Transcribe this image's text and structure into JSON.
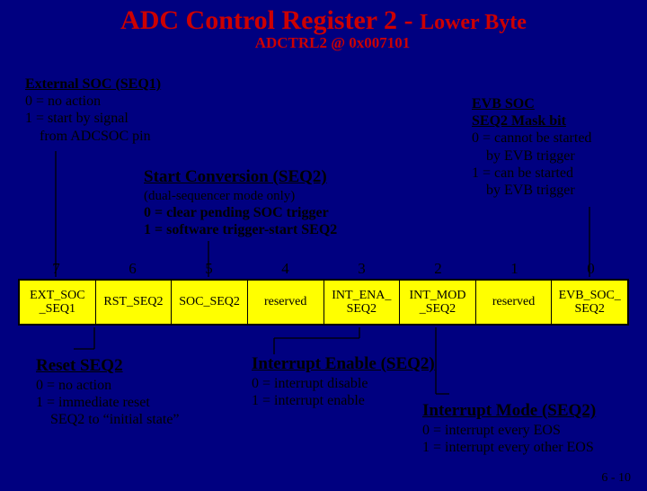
{
  "title_main": "ADC Control Register 2",
  "title_dash": " - ",
  "title_sub": "Lower Byte",
  "subtitle": "ADCTRL2 @ 0x007101",
  "ext_soc": {
    "hdr": "External SOC (SEQ1)",
    "l0": "0 = no action",
    "l1": "1 = start by signal",
    "l2": "    from ADCSOC pin"
  },
  "start_conv": {
    "hdr": "Start Conversion (SEQ2)",
    "note": "(dual-sequencer mode only)",
    "l0": "0 = clear pending SOC trigger",
    "l1": "1 = software trigger-start SEQ2"
  },
  "evb": {
    "hdr1": "EVB SOC",
    "hdr2": "SEQ2 Mask bit",
    "l0": "0 = cannot be started",
    "l0b": "    by EVB trigger",
    "l1": "1 = can be started",
    "l1b": "    by EVB trigger"
  },
  "bits": [
    "7",
    "6",
    "5",
    "4",
    "3",
    "2",
    "1",
    "0"
  ],
  "fields": [
    "EXT_SOC _SEQ1",
    "RST_SEQ2",
    "SOC_SEQ2",
    "reserved",
    "INT_ENA_ SEQ2",
    "INT_MOD _SEQ2",
    "reserved",
    "EVB_SOC_ SEQ2"
  ],
  "reset": {
    "hdr": "Reset SEQ2",
    "l0": "0 = no action",
    "l1": "1 = immediate reset",
    "l2": "    SEQ2 to “initial state”"
  },
  "ien": {
    "hdr": "Interrupt Enable (SEQ2)",
    "l0": "0 = interrupt disable",
    "l1": "1 = interrupt enable"
  },
  "imode": {
    "hdr": "Interrupt Mode (SEQ2)",
    "l0": "0 = interrupt every EOS",
    "l1": "1 = interrupt every other EOS"
  },
  "pagenum": "6 - 10"
}
